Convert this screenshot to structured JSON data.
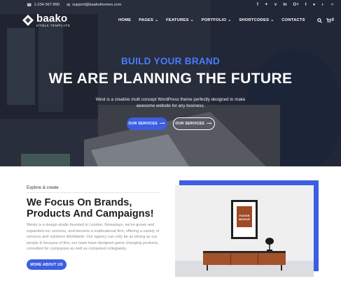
{
  "topbar": {
    "phone": "1-234-567-890",
    "email": "support@baakothemes.com",
    "social_icons": [
      "facebook-icon",
      "twitter-icon",
      "vimeo-icon",
      "linkedin-icon",
      "google-plus-icon",
      "tumblr-icon",
      "pinterest-icon",
      "dribbble-icon",
      "rss-icon"
    ]
  },
  "brand": {
    "name": "baako",
    "tagline": "HTML5 TEMPLATE"
  },
  "nav": {
    "items": [
      {
        "label": "HOME",
        "dropdown": false
      },
      {
        "label": "PAGES",
        "dropdown": true
      },
      {
        "label": "FEATURES",
        "dropdown": true
      },
      {
        "label": "PORTFOLIO",
        "dropdown": true
      },
      {
        "label": "SHORTCODES",
        "dropdown": true
      },
      {
        "label": "CONTACTS",
        "dropdown": false
      }
    ],
    "cart_count": "0"
  },
  "hero": {
    "eyebrow": "BUILD YOUR BRAND",
    "headline": "WE ARE PLANNING THE FUTURE",
    "subtitle": "West is a creative multi concept WordPress theme perfectly designed to make awesome website for any business.",
    "primary_button": "OUR SERVICES",
    "secondary_button": "OUR SERVICES"
  },
  "feature": {
    "kicker": "Explore & create",
    "title": "We Focus On Brands, Products And Campaigns!",
    "paragraph": "Westy is a design studio founded in London. Nowadays, we've grown and expanded our services, and become a multinational firm, offering a variety of services and solutions Worldwide. Our agency can only be as strong as our people & because of this, our team have designed game changing products, consulted for companies as well as competed collegiately.",
    "button": "MORE ABOUT US",
    "poster_text": "POSTER MOCKUP"
  },
  "colors": {
    "accent": "#3d5ee0",
    "eyebrow": "#4a7bff",
    "dark": "#1d1f24"
  }
}
